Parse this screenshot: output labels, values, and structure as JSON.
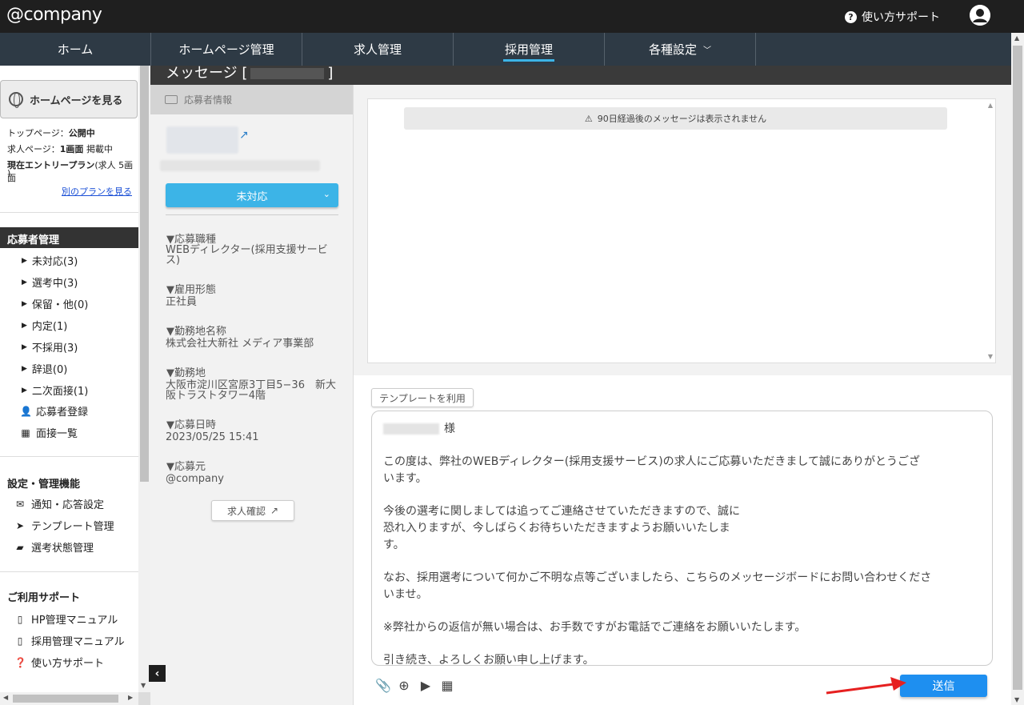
{
  "header": {
    "logo": "@company",
    "support_label": "使い方サポート"
  },
  "nav": {
    "items": [
      {
        "label": "ホーム"
      },
      {
        "label": "ホームページ管理"
      },
      {
        "label": "求人管理"
      },
      {
        "label": "採用管理",
        "active": true
      },
      {
        "label": "各種設定"
      }
    ]
  },
  "sidebar": {
    "homepage_button": "ホームページを見る",
    "top_page_label": "トップページ：",
    "top_page_status": "公開中",
    "job_page_label": "求人ページ：",
    "job_page_count": "1画面",
    "job_page_status": "掲載中",
    "plan_label": "現在エントリープラン",
    "plan_detail": "(求人 5画面",
    "plan_close": ")",
    "other_plan_link": "別のプランを見る",
    "applicant_section": "応募者管理",
    "applicant_items": [
      "未対応(3)",
      "選考中(3)",
      "保留・他(0)",
      "内定(1)",
      "不採用(3)",
      "辞退(0)",
      "二次面接(1)"
    ],
    "register_applicant": "応募者登録",
    "interview_list": "面接一覧",
    "settings_section": "設定・管理機能",
    "notification_settings": "通知・応答設定",
    "template_manage": "テンプレート管理",
    "status_manage": "選考状態管理",
    "support_section": "ご利用サポート",
    "hp_manual": "HP管理マニュアル",
    "recruit_manual": "採用管理マニュアル",
    "usage_support": "使い方サポート"
  },
  "page": {
    "title_prefix": "メッセージ [",
    "title_suffix": "]"
  },
  "applicant": {
    "panel_title": "応募者情報",
    "status": "未対応",
    "fields": [
      {
        "label": "▼応募職種",
        "value": "WEBディレクター(採用支援サービス)"
      },
      {
        "label": "▼雇用形態",
        "value": "正社員"
      },
      {
        "label": "▼勤務地名称",
        "value": "株式会社大新社 メディア事業部"
      },
      {
        "label": "▼勤務地",
        "value": "大阪市淀川区宮原3丁目5−36　新大阪トラストタワー4階"
      },
      {
        "label": "▼応募日時",
        "value": "2023/05/25 15:41"
      },
      {
        "label": "▼応募元",
        "value": "@company"
      }
    ],
    "job_confirm_button": "求人確認"
  },
  "messages": {
    "notice": "90日経過後のメッセージは表示されません"
  },
  "compose": {
    "template_button": "テンプレートを利用",
    "salutation": "様",
    "paragraphs": [
      "この度は、弊社のWEBディレクター(採用支援サービス)の求人にご応募いただきまして誠にありがとうございます。",
      "今後の選考に関しましては追ってご連絡させていただきますので、誠に恐れ入りますが、今しばらくお待ちいただきますようお願いいたします。",
      "なお、採用選考について何かご不明な点等ございましたら、こちらのメッセージボードにお問い合わせくださいませ。",
      "※弊社からの返信が無い場合は、お手数ですがお電話でご連絡をお願いいたします。",
      "引き続き、よろしくお願い申し上げます。"
    ],
    "send_button": "送信",
    "tool_icons": [
      "paperclip-icon",
      "attach-plus-icon",
      "video-icon",
      "calendar-icon"
    ]
  },
  "colors": {
    "accent": "#3cb4e7",
    "send": "#1e8ff0",
    "nav_bg": "#2e3a45",
    "top_bg": "#1f1f1f",
    "annotation_arrow": "#e62020"
  }
}
